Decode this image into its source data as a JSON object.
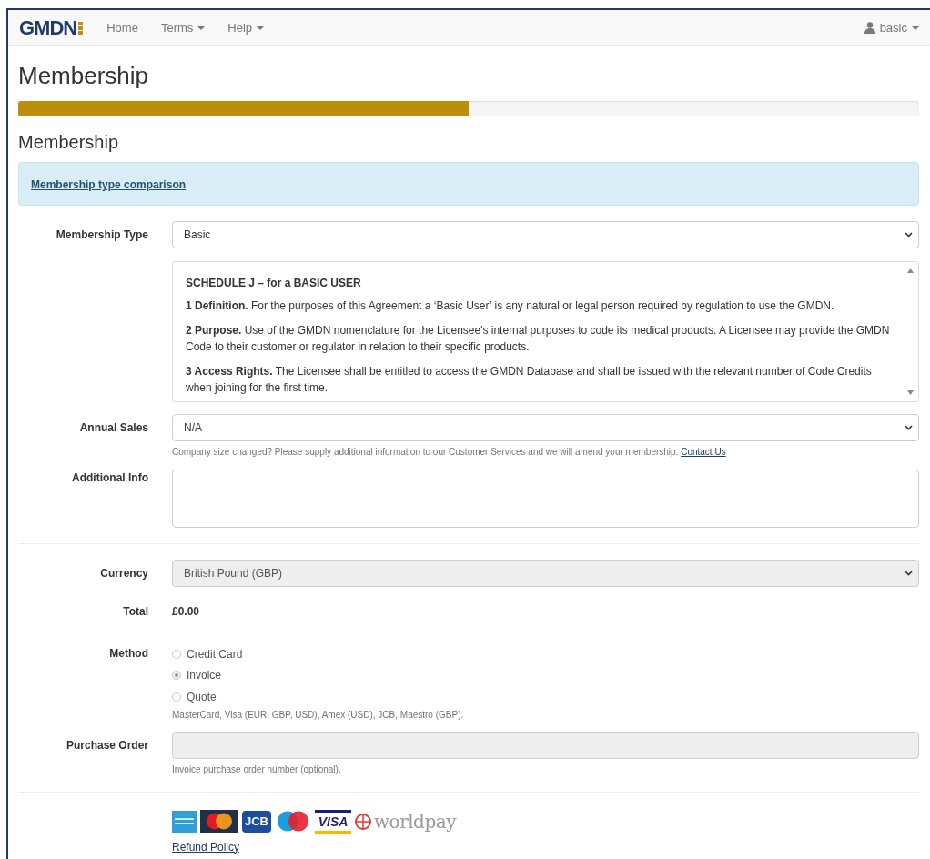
{
  "navbar": {
    "logo": {
      "text": "GMDN"
    },
    "items": [
      {
        "label": "Home",
        "dropdown": false
      },
      {
        "label": "Terms",
        "dropdown": true
      },
      {
        "label": "Help",
        "dropdown": true
      }
    ],
    "user": {
      "label": "basic",
      "dropdown": true
    }
  },
  "page_title": "Membership",
  "progress": {
    "level": 0.5
  },
  "section_title": "Membership",
  "info_alert": {
    "link": "Membership type comparison"
  },
  "form": {
    "membership_type": {
      "label": "Membership Type",
      "value": "Basic"
    },
    "schedule": {
      "title": "SCHEDULE J – for a BASIC USER",
      "clauses": [
        "**1 Definition.** For the purposes of this Agreement a ‘Basic User’ is any natural or legal person required by regulation to use the GMDN.",
        "**2 Purpose.** Use of the GMDN nomenclature for the Licensee's internal purposes to code its medical products. A Licensee may provide the GMDN Code to their customer or regulator in relation to their specific products.",
        "**3 Access Rights.** The Licensee shall be entitled to access the GMDN Database and shall be issued with the relevant number of Code Credits when joining for the first time."
      ]
    },
    "annual_sales": {
      "label": "Annual Sales",
      "value": "N/A",
      "help": "Company size changed? Please supply additional information to our Customer Services and we will amend your membership.",
      "help_link": "Contact Us"
    },
    "additional_info": {
      "label": "Additional Info"
    },
    "currency": {
      "label": "Currency",
      "value": "British Pound (GBP)",
      "disabled": true
    },
    "total": {
      "label": "Total",
      "value": "£0.00"
    },
    "method": {
      "label": "Method",
      "options": [
        {
          "label": "Credit Card",
          "selected": false
        },
        {
          "label": "Invoice",
          "selected": true
        },
        {
          "label": "Quote",
          "selected": false
        }
      ],
      "help": "MasterCard, Visa (EUR, GBP, USD), Amex (USD), JCB, Maestro (GBP)."
    },
    "purchase_order": {
      "label": "Purchase Order",
      "disabled": true,
      "help": "Invoice purchase order number (optional)."
    }
  },
  "payment_logos": [
    {
      "kind": "amex"
    },
    {
      "kind": "mastercard"
    },
    {
      "kind": "jcb",
      "text": "JCB"
    },
    {
      "kind": "maestro"
    },
    {
      "kind": "visa",
      "text": "VISA"
    },
    {
      "kind": "worldpay",
      "text": "worldpay"
    }
  ],
  "refund_link": "Refund Policy"
}
